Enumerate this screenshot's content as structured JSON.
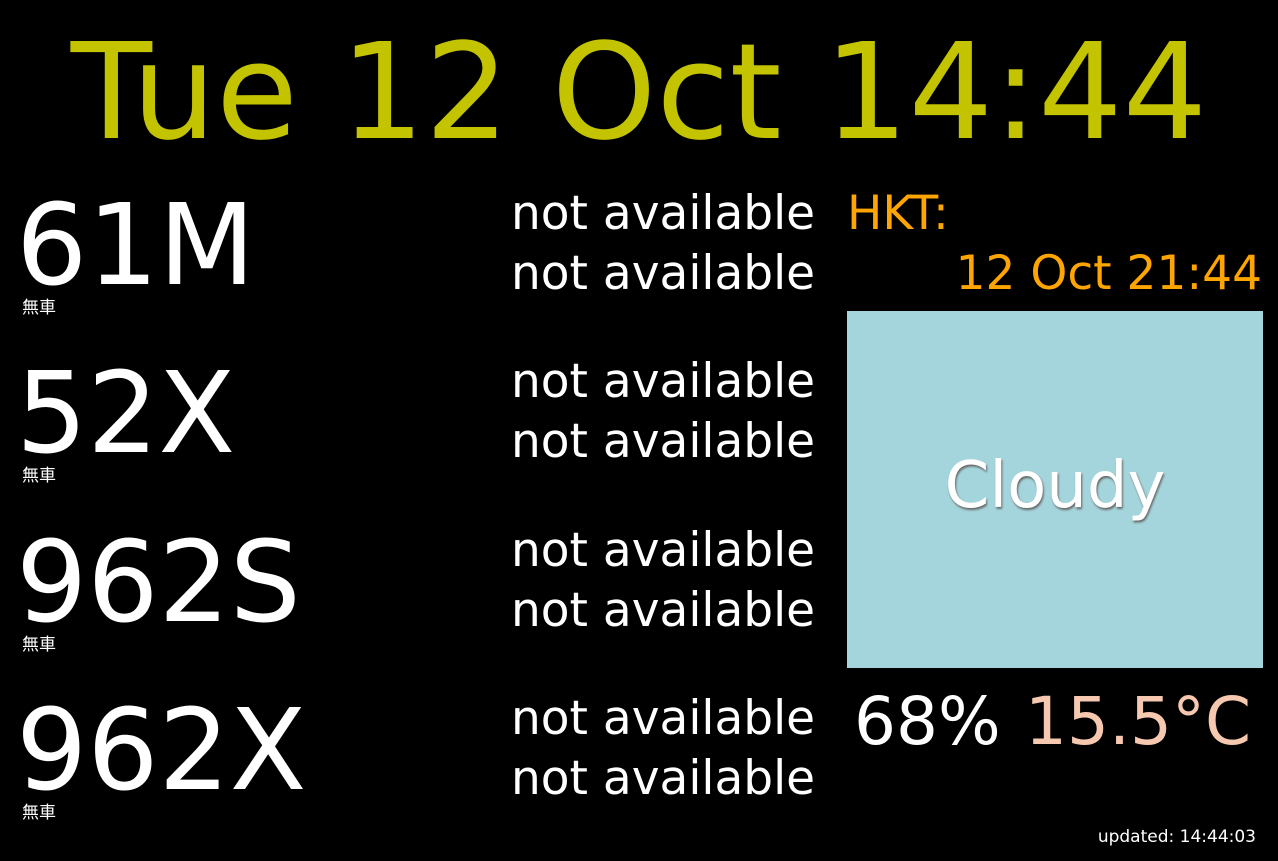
{
  "clock": "Tue 12 Oct 14:44",
  "routes": [
    {
      "number": "61M",
      "status": "無車",
      "eta": [
        "not available",
        "not available"
      ]
    },
    {
      "number": "52X",
      "status": "無車",
      "eta": [
        "not available",
        "not available"
      ]
    },
    {
      "number": "962S",
      "status": "無車",
      "eta": [
        "not available",
        "not available"
      ]
    },
    {
      "number": "962X",
      "status": "無車",
      "eta": [
        "not available",
        "not available"
      ]
    }
  ],
  "hkt": {
    "label": "HKT:",
    "time": "12 Oct 21:44"
  },
  "weather": {
    "condition": "Cloudy",
    "box_color": "#a5d5dc",
    "humidity": "68%",
    "temperature": "15.5°C"
  },
  "updated": "updated: 14:44:03",
  "colors": {
    "clock": "#c3c300",
    "hkt": "#ffa500",
    "temperature": "#f6c8b0",
    "background": "#000000"
  }
}
